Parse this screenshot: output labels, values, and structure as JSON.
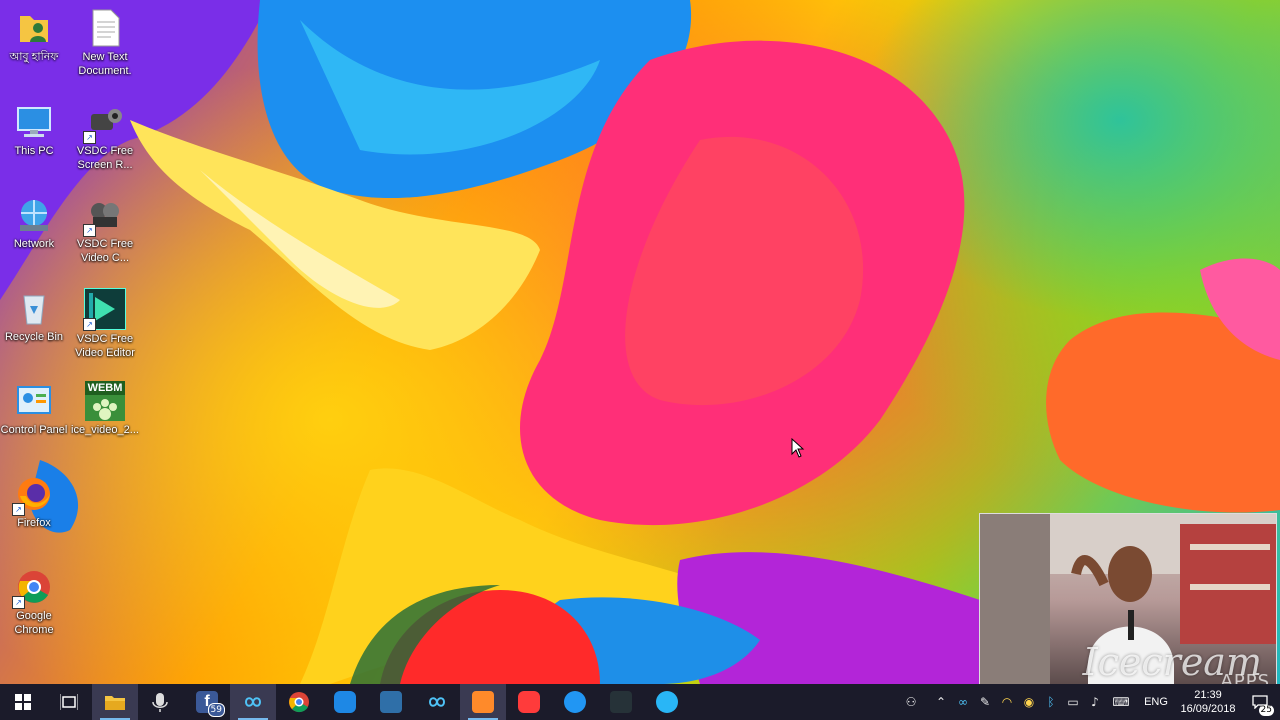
{
  "desktop_icons": [
    {
      "label": "আবু হানিফ",
      "icon": "user-folder-icon"
    },
    {
      "label": "New Text Document.",
      "icon": "text-document-icon"
    },
    {
      "label": "This PC",
      "icon": "computer-icon"
    },
    {
      "label": "VSDC Free Screen R...",
      "icon": "screen-recorder-icon"
    },
    {
      "label": "Network",
      "icon": "network-icon"
    },
    {
      "label": "VSDC Free Video C...",
      "icon": "video-converter-icon"
    },
    {
      "label": "Recycle Bin",
      "icon": "recycle-bin-icon"
    },
    {
      "label": "VSDC Free Video Editor",
      "icon": "video-editor-icon"
    },
    {
      "label": "Control Panel",
      "icon": "control-panel-icon"
    },
    {
      "label": "ice_video_2...",
      "icon": "webm-file-icon"
    },
    {
      "label": "Firefox",
      "icon": "firefox-icon"
    },
    {
      "label": "Google Chrome",
      "icon": "chrome-icon"
    }
  ],
  "webm_badge": "WEBM",
  "webcam": {
    "watermark": "Icecream",
    "watermark_sub": "APPS"
  },
  "taskbar": {
    "facebook_badge": "59",
    "language": "ENG",
    "time": "21:39",
    "date": "16/09/2018",
    "notification_count": "25"
  }
}
